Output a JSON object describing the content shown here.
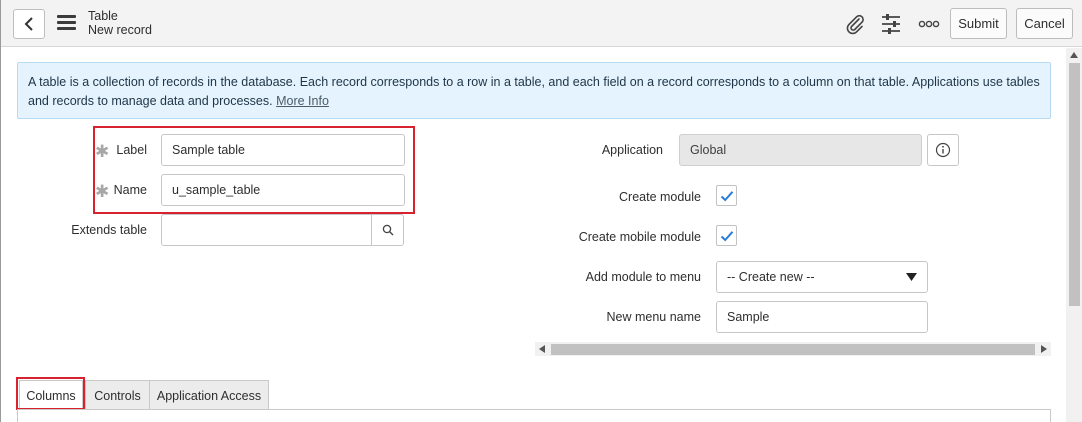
{
  "header": {
    "title": "Table",
    "subtitle": "New record",
    "submit_label": "Submit",
    "cancel_label": "Cancel",
    "icons": [
      "back-icon",
      "menu-icon",
      "paperclip-icon",
      "settings-sliders-icon",
      "more-options-icon"
    ]
  },
  "info": {
    "text": "A table is a collection of records in the database. Each record corresponds to a row in a table, and each field on a record corresponds to a column on that table. Applications use tables and records to manage data and processes.",
    "link": "More Info"
  },
  "form": {
    "label": {
      "label": "Label",
      "value": "Sample table"
    },
    "name": {
      "label": "Name",
      "value": "u_sample_table"
    },
    "extends": {
      "label": "Extends table",
      "value": ""
    },
    "application": {
      "label": "Application",
      "value": "Global"
    },
    "create_module": {
      "label": "Create module",
      "checked": true
    },
    "create_mobile_module": {
      "label": "Create mobile module",
      "checked": true
    },
    "add_module_to_menu": {
      "label": "Add module to menu",
      "selected": "-- Create new --"
    },
    "new_menu_name": {
      "label": "New menu name",
      "value": "Sample"
    }
  },
  "tabs": [
    {
      "label": "Columns",
      "active": true
    },
    {
      "label": "Controls",
      "active": false
    },
    {
      "label": "Application Access",
      "active": false
    }
  ],
  "colors": {
    "highlight": "#d6232f",
    "checkmark": "#2b7bd6",
    "info_bg": "#e4f3fd"
  }
}
